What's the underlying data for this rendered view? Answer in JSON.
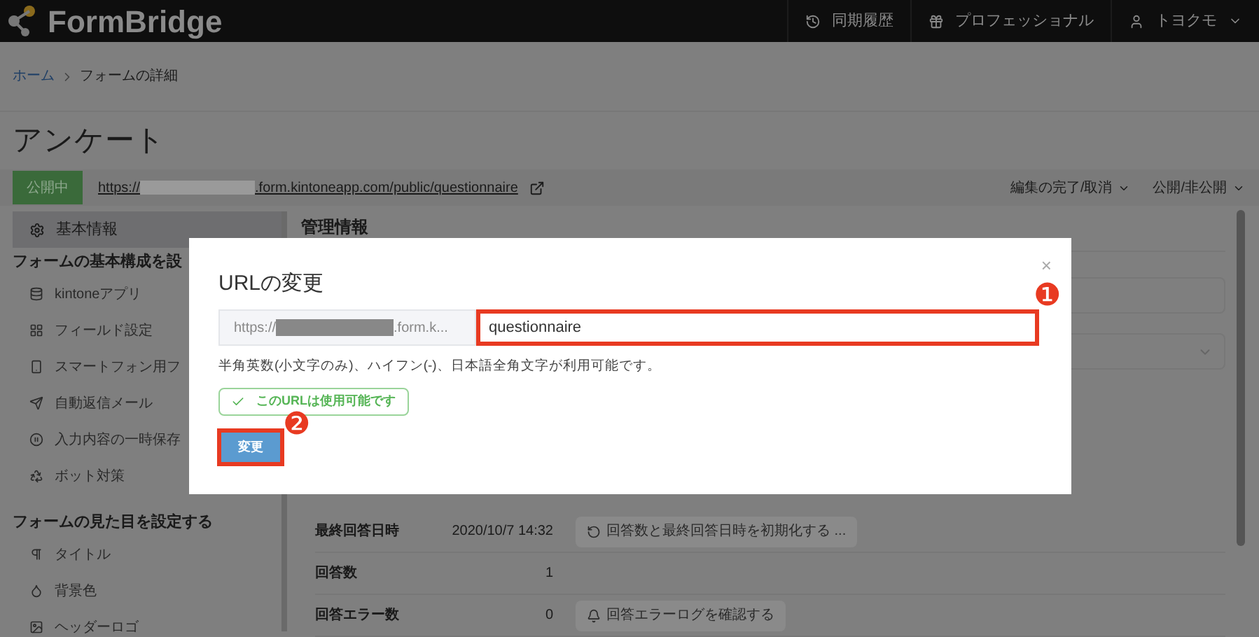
{
  "header": {
    "logo": "FormBridge",
    "items": [
      {
        "kind": "history",
        "label": "同期履歴"
      },
      {
        "kind": "gift",
        "label": "プロフェッショナル"
      },
      {
        "kind": "user",
        "label": "トヨクモ"
      }
    ]
  },
  "breadcrumb": [
    {
      "label": "ホーム",
      "link": true
    },
    {
      "label": "フォームの詳細",
      "link": false
    }
  ],
  "page_title": "アンケート",
  "status_badge": "公開中",
  "public_url": {
    "prefix": "https://",
    "suffix": ".form.kintoneapp.com/public/questionnaire"
  },
  "actions": [
    "編集の完了/取消",
    "公開/非公開"
  ],
  "sidebar": {
    "top_item": {
      "label": "基本情報",
      "selected": true
    },
    "sections": [
      {
        "title": "フォームの基本構成を設",
        "items": [
          {
            "kind": "database",
            "label": "kintoneアプリ"
          },
          {
            "kind": "grid",
            "label": "フィールド設定"
          },
          {
            "kind": "phone",
            "label": "スマートフォン用フ"
          },
          {
            "kind": "send",
            "label": "自動返信メール"
          },
          {
            "kind": "pause",
            "label": "入力内容の一時保存"
          },
          {
            "kind": "recycle",
            "label": "ボット対策"
          }
        ]
      },
      {
        "title": "フォームの見た目を設定する",
        "items": [
          {
            "kind": "paragraph",
            "label": "タイトル"
          },
          {
            "kind": "drop",
            "label": "背景色"
          },
          {
            "kind": "image",
            "label": "ヘッダーロゴ"
          }
        ]
      }
    ]
  },
  "main": {
    "heading": "管理情報",
    "stats": [
      {
        "label": "最終回答日時",
        "value": "2020/10/7 14:32",
        "button": {
          "kind": "reset",
          "label": "回答数と最終回答日時を初期化する ..."
        }
      },
      {
        "label": "回答数",
        "value": "1"
      },
      {
        "label": "回答エラー数",
        "value": "0",
        "button": {
          "kind": "bell",
          "label": "回答エラーログを確認する"
        }
      }
    ]
  },
  "dialog": {
    "title": "URLの変更",
    "close": "×",
    "url_prefix": "https://",
    "url_suffix": ".form.k...",
    "slug": "questionnaire",
    "hint": "半角英数(小文字のみ)、ハイフン(-)、日本語全角文字が利用可能です。",
    "availability": "このURLは使用可能です",
    "submit": "変更"
  },
  "annotations": [
    "❶",
    "❷"
  ]
}
